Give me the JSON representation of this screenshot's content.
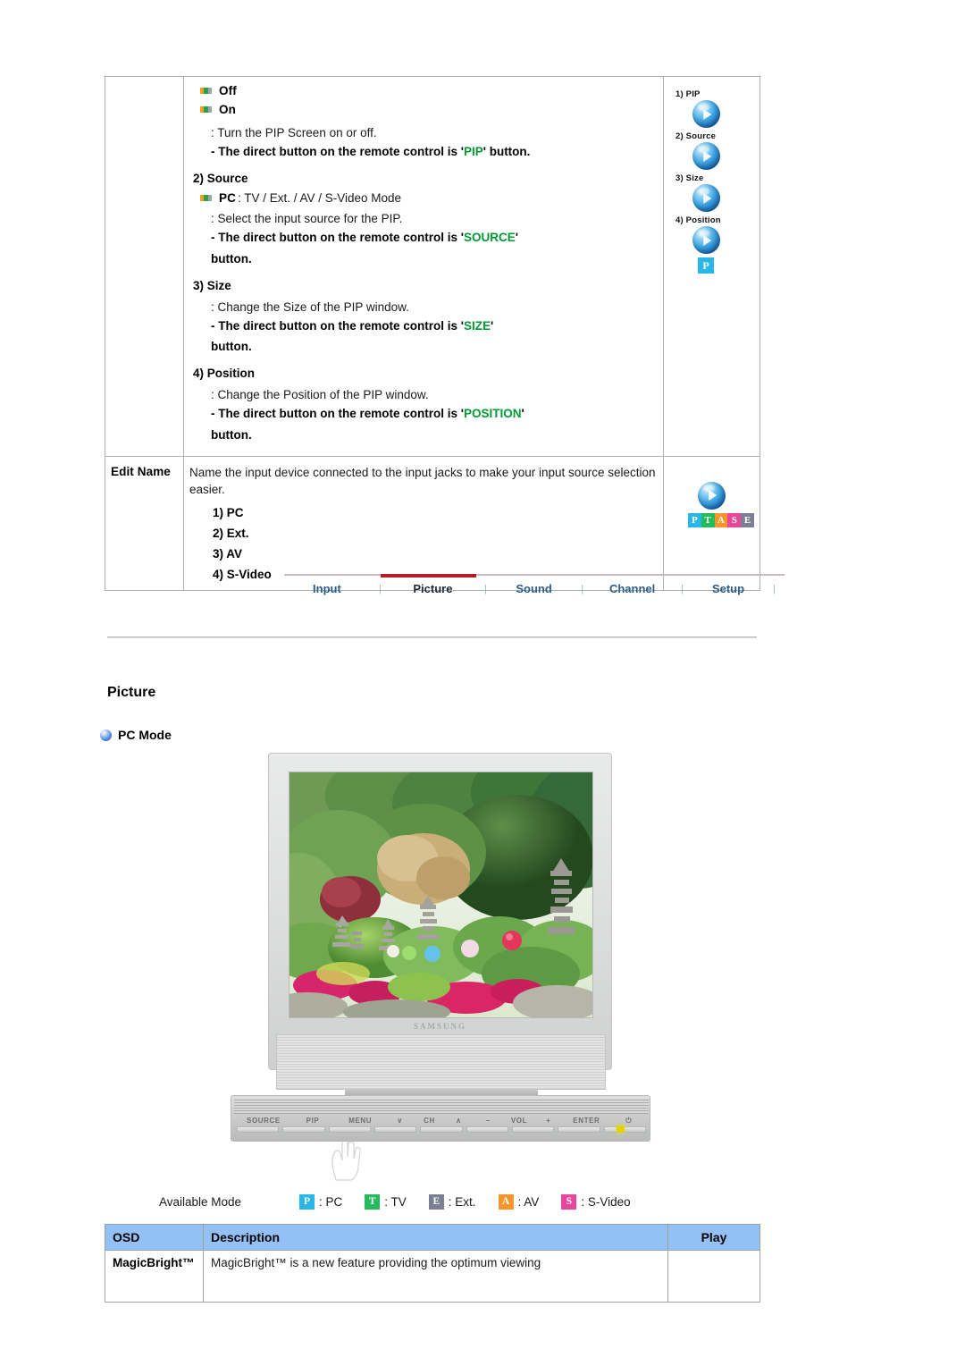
{
  "spec_table": {
    "pip_row": {
      "label": "",
      "options": [
        {
          "name": "Off",
          "rest": ""
        },
        {
          "name": "On",
          "rest": ""
        }
      ],
      "desc": ": Turn the PIP Screen on or off.",
      "note_prefix": "- The direct button on the remote control is '",
      "note_key": "PIP",
      "note_suffix": "' button.",
      "source_head": "2) Source",
      "source_option_name": "PC",
      "source_option_rest": ": TV / Ext. / AV / S-Video Mode",
      "source_desc": ": Select the input source for the PIP.",
      "source_note_prefix": "- The direct button on the remote control is '",
      "source_note_key": "SOURCE",
      "source_note_suffix": "'",
      "source_note_cont": "button.",
      "size_head": "3) Size",
      "size_desc": ": Change the Size of the PIP window.",
      "size_note_prefix": "- The direct button on the remote control is '",
      "size_note_key": "SIZE",
      "size_note_suffix": "'",
      "size_note_cont": "button.",
      "position_head": "4) Position",
      "position_desc": ": Change the Position of the PIP window.",
      "position_note_prefix": "- The direct button on the remote control is '",
      "position_note_key": "POSITION",
      "position_note_suffix": "'",
      "position_note_cont": "button.",
      "icons": [
        {
          "label": "1) PIP"
        },
        {
          "label": "2) Source"
        },
        {
          "label": "3) Size"
        },
        {
          "label": "4) Position"
        }
      ],
      "icon_tag": "P"
    },
    "edit_name_row": {
      "label": "Edit Name",
      "body": "Name the input device connected to the input jacks to make your input source selection easier.",
      "items": [
        "1) PC",
        "2) Ext.",
        "3) AV",
        "4) S-Video"
      ],
      "badges": [
        "P",
        "T",
        "A",
        "S",
        "E"
      ]
    }
  },
  "nav": {
    "tabs": [
      {
        "label": "Input",
        "active": false
      },
      {
        "label": "Picture",
        "active": true
      },
      {
        "label": "Sound",
        "active": false
      },
      {
        "label": "Channel",
        "active": false
      },
      {
        "label": "Setup",
        "active": false
      }
    ],
    "separator": "|",
    "accent_color": "#b61e27"
  },
  "picture_section": {
    "title": "Picture",
    "pc_mode_label": "PC Mode"
  },
  "monitor": {
    "brand": "SAMSUNG",
    "control_labels": [
      "SOURCE",
      "PIP",
      "MENU",
      "∨",
      "CH",
      "∧",
      "−",
      "VOL",
      "+",
      "ENTER",
      "⏻"
    ]
  },
  "available_mode": {
    "label": "Available Mode",
    "modes": [
      {
        "badge": "P",
        "text": ": PC"
      },
      {
        "badge": "T",
        "text": ": TV"
      },
      {
        "badge": "E",
        "text": ": Ext."
      },
      {
        "badge": "A",
        "text": ": AV"
      },
      {
        "badge": "S",
        "text": ": S-Video"
      }
    ]
  },
  "osd_table": {
    "headers": [
      "OSD",
      "Description",
      "Play"
    ],
    "rows": [
      {
        "osd": "MagicBright™",
        "description": "MagicBright™ is a new feature providing the optimum viewing",
        "play": ""
      }
    ]
  }
}
